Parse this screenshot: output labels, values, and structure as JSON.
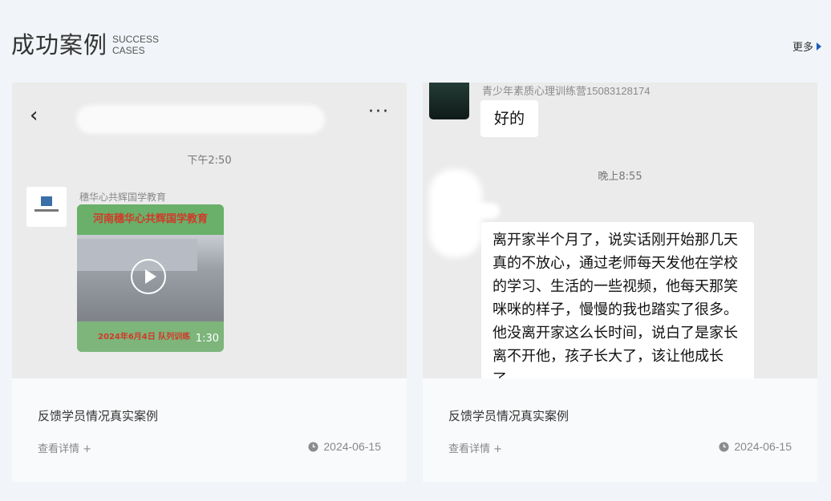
{
  "header": {
    "title_cn": "成功案例",
    "title_en_line1": "SUCCESS",
    "title_en_line2": "CASES",
    "more_label": "更多"
  },
  "cases": [
    {
      "title": "反馈学员情况真实案例",
      "detail_label": "查看详情 +",
      "date": "2024-06-15",
      "screenshot": {
        "back_glyph": "‹",
        "more_glyph": "···",
        "time": "下午2:50",
        "sender": "穗华心共辉国学教育",
        "video_banner": "河南穗华心共辉国学教育",
        "video_date": "2024年6月4日  队列训练",
        "video_duration": "1:30"
      }
    },
    {
      "title": "反馈学员情况真实案例",
      "detail_label": "查看详情 +",
      "date": "2024-06-15",
      "screenshot": {
        "sender": "青少年素质心理训练营15083128174",
        "reply": "好的",
        "time": "晚上8:55",
        "message": "离开家半个月了，说实话刚开始那几天真的不放心，通过老师每天发他在学校的学习、生活的一些视频，他每天那笑咪咪的样子，慢慢的我也踏实了很多。他没离开家这么长时间，说白了是家长离不开他，孩子长大了，该让他成长了。"
      }
    }
  ],
  "icons": {
    "more_arrow": "triangle-right-icon",
    "date_icon": "clock-icon"
  },
  "colors": {
    "accent": "#1e5db5",
    "page_bg": "#f1f4f8",
    "chat_bg": "#ebebeb"
  }
}
